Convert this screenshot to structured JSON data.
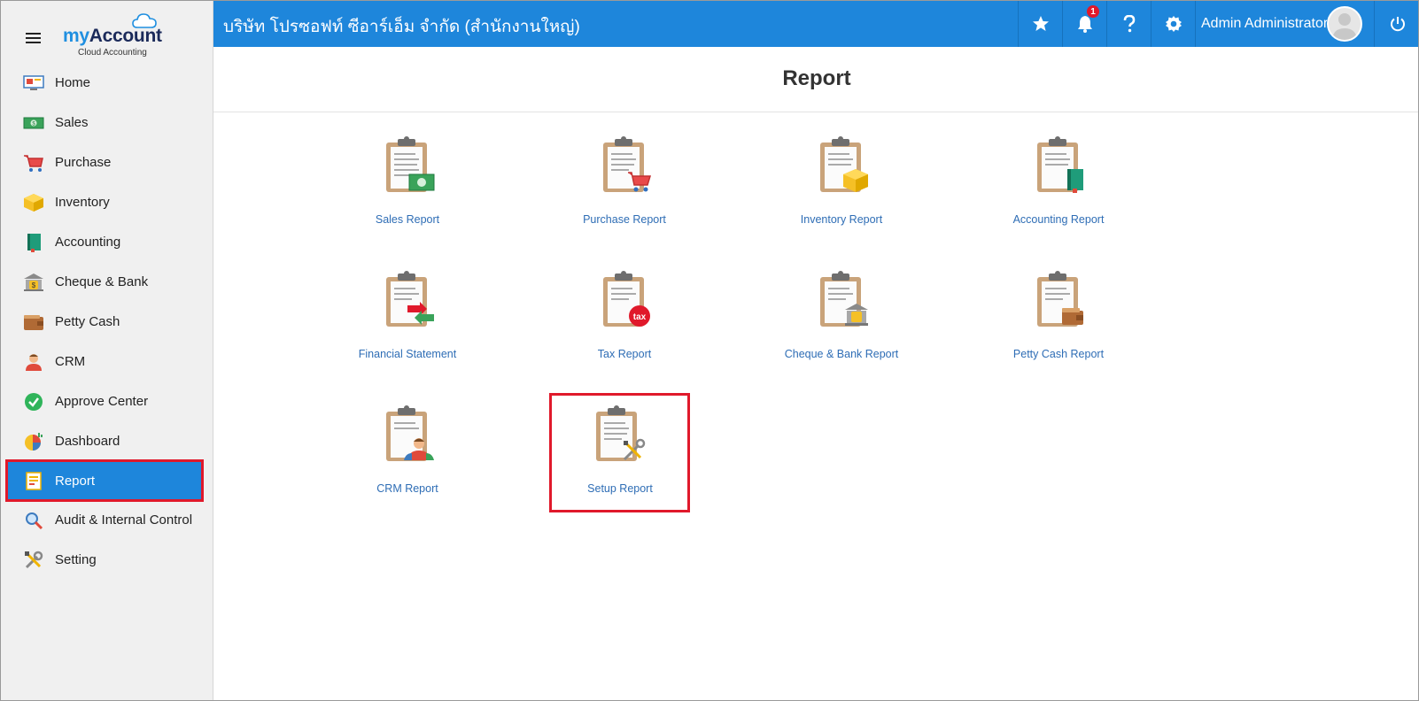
{
  "app": {
    "logo_my": "my",
    "logo_account": "Account",
    "logo_sub": "Cloud Accounting",
    "company_name": "บริษัท โปรซอฟท์ ซีอาร์เอ็ม จำกัด (สำนักงานใหญ่)",
    "accent_color": "#1e86db",
    "highlight_color": "#e0192b"
  },
  "topbar": {
    "notification_count": "1",
    "user_name": "Admin Administrator",
    "icons": [
      "star-icon",
      "bell-icon",
      "help-icon",
      "gear-icon",
      "avatar",
      "power-icon"
    ]
  },
  "sidebar": {
    "items": [
      {
        "label": "Home",
        "icon": "home-icon"
      },
      {
        "label": "Sales",
        "icon": "money-icon"
      },
      {
        "label": "Purchase",
        "icon": "cart-icon"
      },
      {
        "label": "Inventory",
        "icon": "box-icon"
      },
      {
        "label": "Accounting",
        "icon": "book-icon"
      },
      {
        "label": "Cheque & Bank",
        "icon": "bank-icon"
      },
      {
        "label": "Petty Cash",
        "icon": "wallet-icon"
      },
      {
        "label": "CRM",
        "icon": "people-icon"
      },
      {
        "label": "Approve Center",
        "icon": "check-icon"
      },
      {
        "label": "Dashboard",
        "icon": "pie-chart-icon"
      },
      {
        "label": "Report",
        "icon": "report-icon",
        "active": true
      },
      {
        "label": "Audit & Internal Control",
        "icon": "magnifier-icon"
      },
      {
        "label": "Setting",
        "icon": "tools-icon"
      }
    ]
  },
  "main": {
    "title": "Report",
    "tiles": [
      {
        "label": "Sales Report",
        "icon": "sales-report-icon"
      },
      {
        "label": "Purchase Report",
        "icon": "purchase-report-icon"
      },
      {
        "label": "Inventory Report",
        "icon": "inventory-report-icon"
      },
      {
        "label": "Accounting Report",
        "icon": "accounting-report-icon"
      },
      {
        "label": "Financial Statement",
        "icon": "financial-statement-icon"
      },
      {
        "label": "Tax Report",
        "icon": "tax-report-icon",
        "badge": "tax"
      },
      {
        "label": "Cheque & Bank Report",
        "icon": "cheque-bank-report-icon"
      },
      {
        "label": "Petty Cash Report",
        "icon": "petty-cash-report-icon"
      },
      {
        "label": "CRM Report",
        "icon": "crm-report-icon"
      },
      {
        "label": "Setup Report",
        "icon": "setup-report-icon",
        "highlighted": true
      }
    ]
  }
}
